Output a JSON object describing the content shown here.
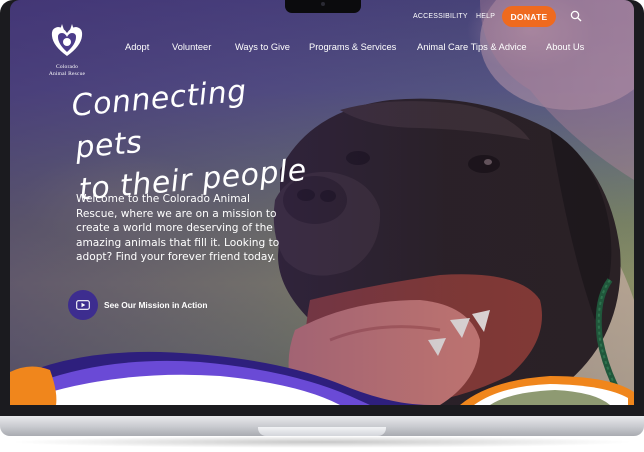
{
  "org": {
    "name": "Colorado Animal Rescue",
    "name_line1": "Colorado",
    "name_line2": "Animal Rescue"
  },
  "utility_nav": {
    "accessibility": "ACCESSIBILITY",
    "help": "HELP",
    "donate": "DONATE",
    "search_icon": "search-icon"
  },
  "nav": {
    "items": [
      {
        "label": "Adopt"
      },
      {
        "label": "Volunteer"
      },
      {
        "label": "Ways to Give"
      },
      {
        "label": "Programs & Services"
      },
      {
        "label": "Animal Care Tips & Advice"
      },
      {
        "label": "About Us"
      }
    ]
  },
  "hero": {
    "headline_line1": "Connecting pets",
    "headline_line2": "to their people",
    "intro": "Welcome to the Colorado Animal Rescue, where we are on a mission to create a world more deserving of the amazing animals that fill it. Looking to adopt? Find your forever friend today.",
    "cta_label": "See Our Mission in Action",
    "cta_icon": "play-video-icon"
  },
  "colors": {
    "brand_purple": "#3d2d8f",
    "donate_orange": "#ef6a1f",
    "wave_purple": "#5b3fc4",
    "accent_orange": "#f08a1c"
  }
}
